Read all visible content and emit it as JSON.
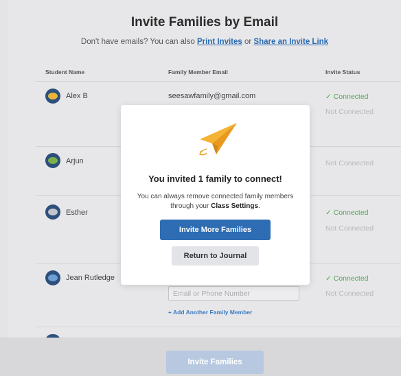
{
  "page": {
    "title": "Invite Families by Email",
    "subtitle_prefix": "Don't have emails? You can also ",
    "print_link": "Print Invites",
    "subtitle_middle": " or ",
    "share_link": "Share an Invite Link"
  },
  "table": {
    "headers": {
      "student": "Student Name",
      "email": "Family Member Email",
      "status": "Invite Status"
    },
    "rows": [
      {
        "name": "Alex B",
        "email": "seesawfamily@gmail.com",
        "status1": "✓ Connected",
        "status2": "Not Connected",
        "avatar": "bee"
      },
      {
        "name": "Arjun",
        "status1": "Not Connected",
        "avatar": "fish"
      },
      {
        "name": "Esther",
        "status1": "✓ Connected",
        "status2": "Not Connected",
        "avatar": "mouse"
      },
      {
        "name": "Jean Rutledge",
        "status1": "✓ Connected",
        "status2": "Not Connected",
        "avatar": "whale"
      }
    ],
    "phone_placeholder": "Email or Phone Number",
    "add_member": "+ Add Another Family Member"
  },
  "footer": {
    "invite_button": "Invite Families"
  },
  "modal": {
    "title": "You invited 1 family to connect!",
    "body_prefix": "You can always remove connected family members through your ",
    "body_bold": "Class Settings",
    "body_suffix": ".",
    "primary_button": "Invite More Families",
    "secondary_button": "Return to Journal",
    "icon": "paper-plane-icon"
  },
  "colors": {
    "primary": "#2e6db4",
    "link": "#2a6ab0",
    "connected": "#52a552",
    "not_connected": "#b8b8bc",
    "plane": "#f5b335"
  }
}
